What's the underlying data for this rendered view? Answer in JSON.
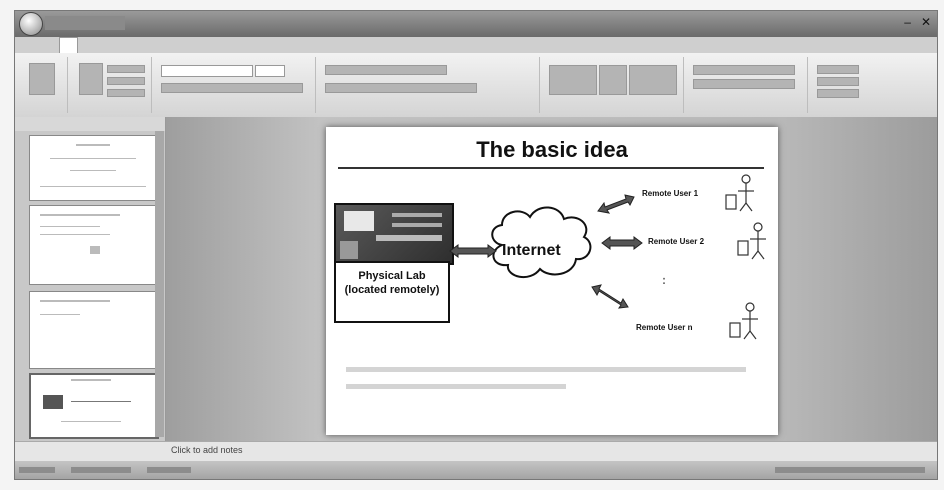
{
  "slide": {
    "title": "The basic idea",
    "lab_label": "Physical Lab (located remotely)",
    "cloud_label": "Internet",
    "user_1": "Remote User 1",
    "user_2": "Remote User 2",
    "user_n": "Remote User n",
    "ellipsis": ":"
  },
  "notes": {
    "placeholder": "Click to add notes"
  },
  "colors": {
    "titlebar": "#7a7a7a",
    "slide_background": "#ffffff",
    "editor_background": "#b0b0b0"
  },
  "icons": {
    "office_button": "office-logo-icon",
    "minimize": "minimize-icon",
    "close": "close-icon"
  }
}
